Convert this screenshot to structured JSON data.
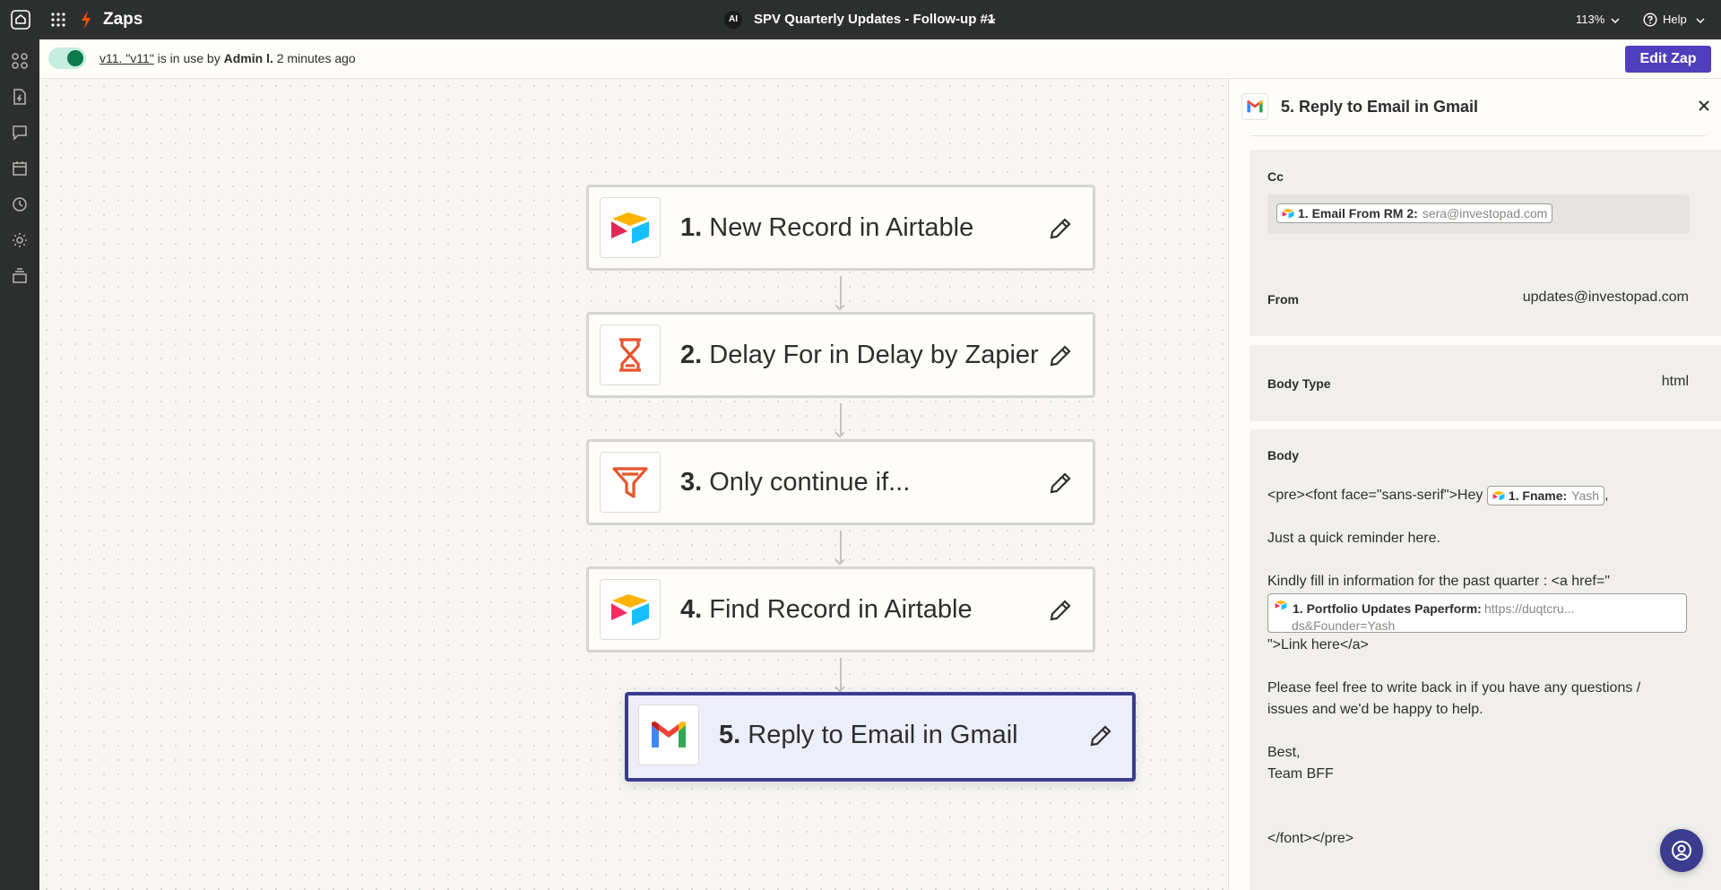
{
  "topbar": {
    "brand": "Zaps",
    "ai_badge": "AI",
    "zap_title": "SPV Quarterly Updates - Follow-up #1",
    "zoom": "113%",
    "help": "Help"
  },
  "sidebar": {
    "items": [
      "apps-icon",
      "file-zap-icon",
      "comment-icon",
      "calendar-icon",
      "history-icon",
      "settings-icon",
      "layers-icon"
    ]
  },
  "status": {
    "version_link": "v11. \"v11\"",
    "text_a": " is in use by ",
    "user": "Admin l.",
    "text_b": " 2 minutes ago",
    "toggle_on": true,
    "edit_button": "Edit Zap"
  },
  "steps": [
    {
      "num": "1.",
      "label": " New Record in Airtable",
      "app": "airtable"
    },
    {
      "num": "2.",
      "label": " Delay For in Delay by Zapier",
      "app": "delay"
    },
    {
      "num": "3.",
      "label": " Only continue if...",
      "app": "filter"
    },
    {
      "num": "4.",
      "label": " Find Record in Airtable",
      "app": "airtable"
    },
    {
      "num": "5.",
      "label": " Reply to Email in Gmail",
      "app": "gmail",
      "selected": true
    }
  ],
  "panel": {
    "title": "5. Reply to Email in Gmail",
    "cc": {
      "label": "Cc",
      "pill_label": "1. Email From RM 2:",
      "pill_value": "sera@investopad.com"
    },
    "from": {
      "label": "From",
      "value": "updates@investopad.com"
    },
    "body_type": {
      "label": "Body Type",
      "value": "html"
    },
    "body": {
      "label": "Body",
      "line1_a": "<pre><font face=\"sans-serif\">Hey ",
      "fname_label": "1. Fname:",
      "fname_value": "Yash",
      "line1_b": ",",
      "line3": "Just a quick reminder here.",
      "line5": "Kindly fill in information for the past quarter : <a href=\"",
      "url_label": "1. Portfolio Updates Paperform:",
      "url_value_1": "https://duqtcru...",
      "url_value_2": "ds&Founder=Yash",
      "line6": "\">Link here</a>",
      "line8": "Please feel free to write back in if you have any questions /",
      "line9": "issues and we'd be happy to help.",
      "line11": "Best,",
      "line12": "Team BFF",
      "line15": "</font></pre>"
    }
  },
  "colors": {
    "topbar": "#2d2e2e",
    "accent": "#503ebd",
    "zapier_orange": "#ff4f00",
    "toggle_on": "#0b7a4e",
    "selected_border": "#3b3c8f"
  }
}
